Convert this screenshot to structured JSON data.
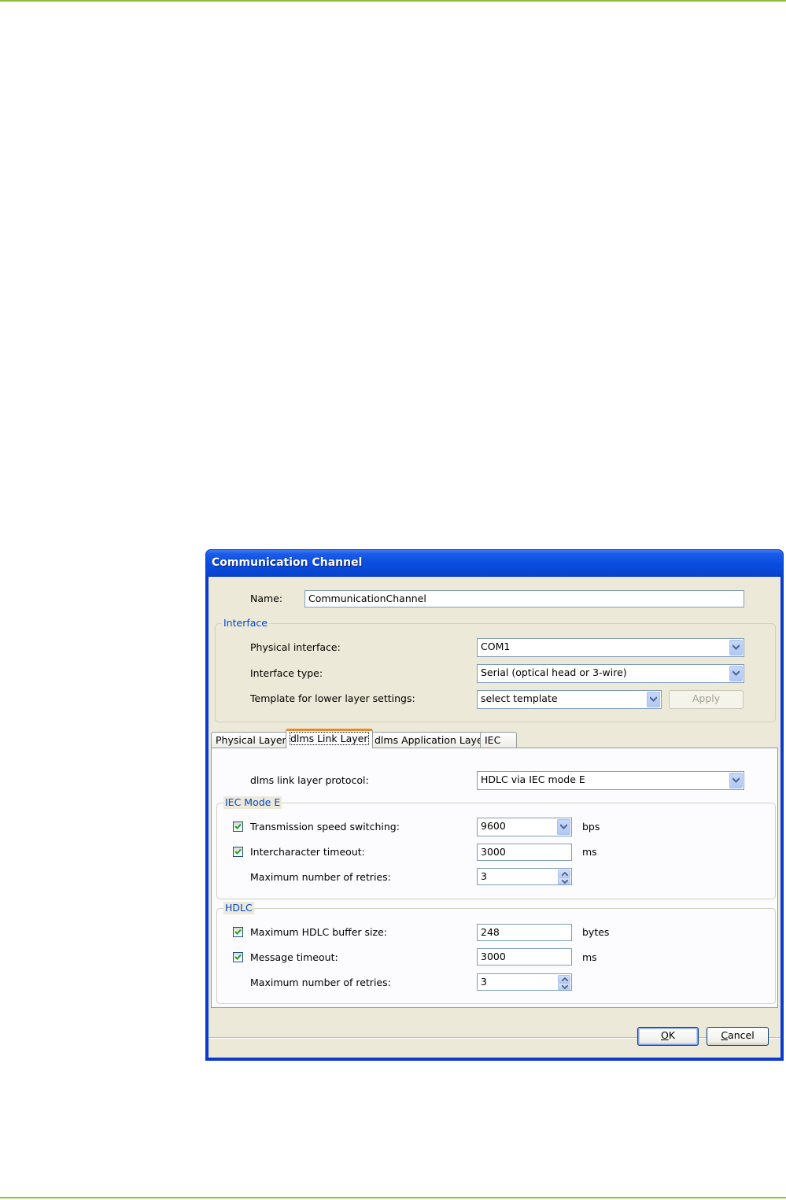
{
  "window": {
    "title": "Communication Channel"
  },
  "name_field": {
    "label": "Name:",
    "value": "CommunicationChannel"
  },
  "interface": {
    "legend": "Interface",
    "physical_interface": {
      "label": "Physical interface:",
      "value": "COM1"
    },
    "interface_type": {
      "label": "Interface type:",
      "value": "Serial (optical head or 3-wire)"
    },
    "template": {
      "label": "Template for lower layer settings:",
      "value": "select template",
      "apply_label": "Apply"
    }
  },
  "tabs": [
    {
      "label": "Physical Layer"
    },
    {
      "label": "dlms Link Layer",
      "active": true
    },
    {
      "label": "dlms Application Layer"
    },
    {
      "label": "IEC"
    }
  ],
  "link_layer": {
    "protocol": {
      "label": "dlms link layer protocol:",
      "value": "HDLC via IEC mode E"
    },
    "iec_mode_e": {
      "legend": "IEC Mode E",
      "speed_switching": {
        "label": "Transmission speed switching:",
        "checked": true,
        "value": "9600",
        "unit": "bps"
      },
      "intercharacter_timeout": {
        "label": "Intercharacter timeout:",
        "checked": true,
        "value": "3000",
        "unit": "ms"
      },
      "max_retries": {
        "label": "Maximum number of retries:",
        "value": "3"
      }
    },
    "hdlc": {
      "legend": "HDLC",
      "buffer_size": {
        "label": "Maximum HDLC buffer size:",
        "checked": true,
        "value": "248",
        "unit": "bytes"
      },
      "message_timeout": {
        "label": "Message timeout:",
        "checked": true,
        "value": "3000",
        "unit": "ms"
      },
      "max_retries": {
        "label": "Maximum number of retries:",
        "value": "3"
      }
    }
  },
  "buttons": {
    "ok": {
      "mnemonic": "O",
      "rest": "K"
    },
    "cancel": {
      "mnemonic": "C",
      "rest": "ancel"
    }
  },
  "colors": {
    "accent_rule": "#8bbf3a",
    "titlebar": "#0a4ee0",
    "legend_text": "#0046d5",
    "checkmark": "#21a121"
  }
}
